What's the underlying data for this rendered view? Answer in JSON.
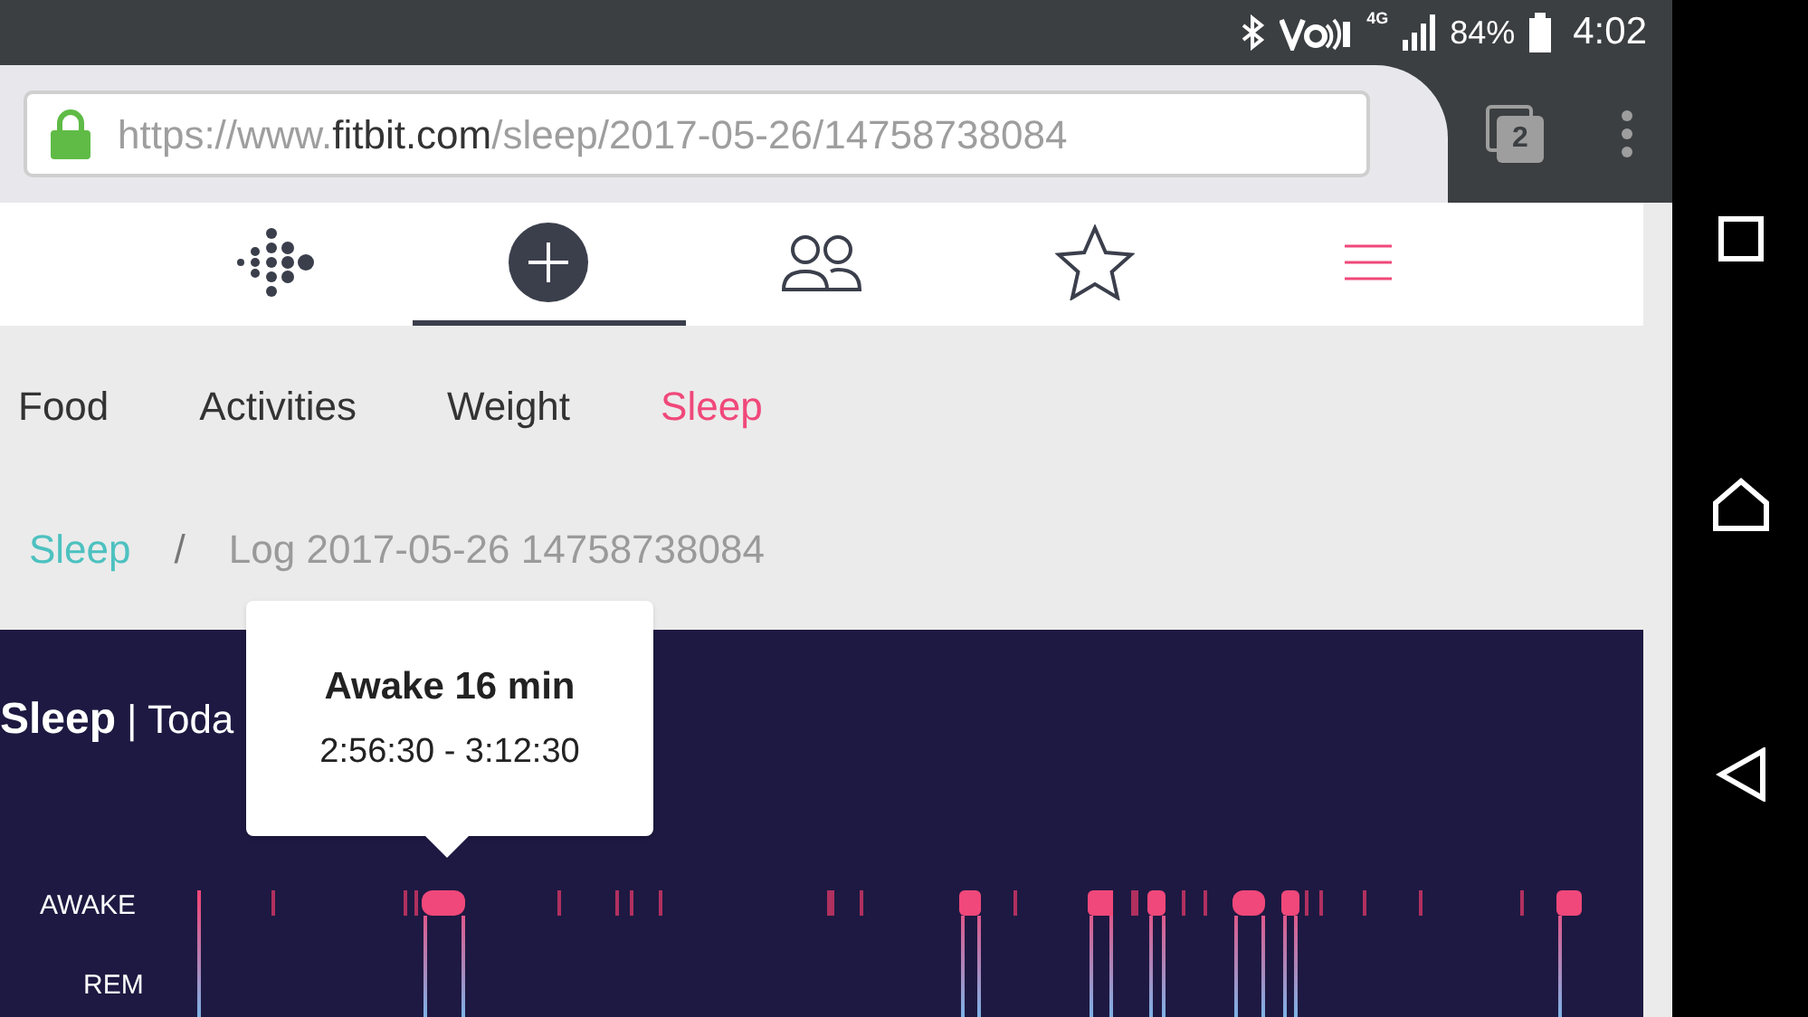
{
  "status_bar": {
    "battery": "84%",
    "time": "4:02",
    "network": "4G"
  },
  "browser": {
    "url_scheme": "https://www.",
    "url_domain": "fitbit.com",
    "url_path": "/sleep/2017-05-26/14758738084",
    "tab_count": "2"
  },
  "nav_tabs": [
    {
      "kind": "logo",
      "selected": false
    },
    {
      "kind": "add",
      "selected": true
    },
    {
      "kind": "friends",
      "selected": false
    },
    {
      "kind": "favorites",
      "selected": false
    },
    {
      "kind": "menu",
      "selected": false
    }
  ],
  "sections": [
    {
      "label": "Food",
      "selected": false
    },
    {
      "label": "Activities",
      "selected": false
    },
    {
      "label": "Weight",
      "selected": false
    },
    {
      "label": "Sleep",
      "selected": true
    }
  ],
  "breadcrumb": {
    "link": "Sleep",
    "separator": "/",
    "current": "Log 2017-05-26 14758738084"
  },
  "panel": {
    "title": "Sleep",
    "subtitle": "| Toda",
    "stage_labels": [
      "AWAKE",
      "REM"
    ]
  },
  "tooltip": {
    "title": "Awake 16 min",
    "range": "2:56:30 - 3:12:30"
  }
}
